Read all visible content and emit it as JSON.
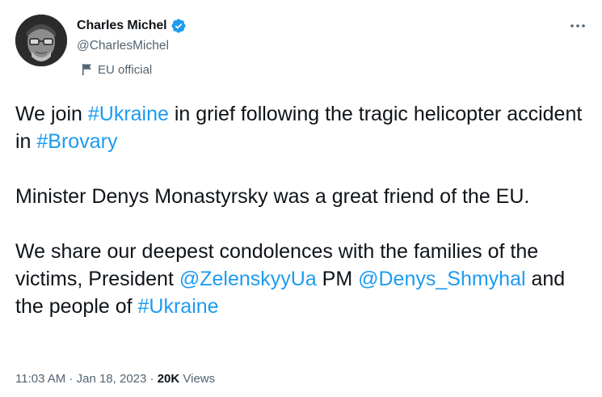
{
  "author": {
    "display_name": "Charles Michel",
    "handle": "@CharlesMichel",
    "label": "EU official"
  },
  "icons": {
    "verified": "verified-badge-icon",
    "label": "flag-icon",
    "more": "more-options-icon"
  },
  "colors": {
    "link": "#1d9bf0",
    "text": "#0f1419",
    "muted": "#536471"
  },
  "tweet": {
    "p1": {
      "t1": "We join ",
      "tag1": "#Ukraine",
      "t2": " in grief following the tragic helicopter accident in ",
      "tag2": "#Brovary"
    },
    "p2": "Minister Denys Monastyrsky was a great friend of the EU.",
    "p3": {
      "t1": "We share our deepest condolences with the families of the victims, President ",
      "mention1": "@ZelenskyyUa",
      "t2": " PM ",
      "mention2": "@Denys_Shmyhal",
      "t3": " and the people of ",
      "tag3": "#Ukraine"
    }
  },
  "meta": {
    "time": "11:03 AM",
    "sep1": " · ",
    "date": "Jan 18, 2023",
    "sep2": " · ",
    "views_count": "20K",
    "views_label": " Views"
  }
}
